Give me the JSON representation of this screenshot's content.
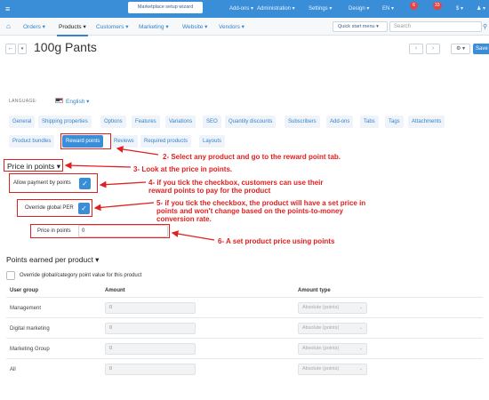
{
  "topbar": {
    "wizard_label": "Marketplace setup wizard",
    "items": [
      "Add-ons ▾",
      "Administration ▾",
      "Settings ▾",
      "Design ▾",
      "EN ▾",
      "$ ▾"
    ],
    "badge_a": "6",
    "badge_b": "33"
  },
  "nav": {
    "items": [
      "Orders ▾",
      "Products ▾",
      "Customers ▾",
      "Marketing ▾",
      "Website ▾",
      "Vendors ▾"
    ],
    "quick_start": "Quick start menu ▾",
    "search_placeholder": "Search"
  },
  "header": {
    "title": "100g Pants",
    "save_label": "Save",
    "gear_label": "⚙ ▾"
  },
  "language": {
    "label": "LANGUAGE:",
    "value": "English ▾"
  },
  "tabs_row1": [
    "General",
    "Shipping properties",
    "Options",
    "Features",
    "Variations",
    "SEO",
    "Quantity discounts",
    "Subscribers",
    "Add-ons",
    "Tabs",
    "Tags",
    "Attachments"
  ],
  "tabs_row2": [
    "Product bundles",
    "Reward points",
    "Reviews",
    "Required products",
    "Layouts"
  ],
  "price_section": {
    "heading": "Price in points ▾",
    "allow_payment_label": "Allow payment by points",
    "override_per_label": "Override global PER",
    "price_label": "Price in points",
    "price_value": "0"
  },
  "annotations": {
    "a2": "2- Select any product and go to the reward point tab.",
    "a3": "3- Look at the price in points.",
    "a4_line1": "4- if you tick the checkbox, customers can use their",
    "a4_line2": "reward points to pay for the product",
    "a5_line1": "5- if you tick the checkbox, the product will have a set price in",
    "a5_line2": "points and won't change based on the points-to-money",
    "a5_line3": "conversion rate.",
    "a6": "6- A set product price using points"
  },
  "earned_section": {
    "heading": "Points earned per product ▾",
    "override_label": "Override global/category point value for this product",
    "columns": [
      "User group",
      "Amount",
      "Amount type"
    ],
    "rows": [
      {
        "group": "Management",
        "amount": "0",
        "type": "Absolute (points)"
      },
      {
        "group": "Digital marketing",
        "amount": "0",
        "type": "Absolute (points)"
      },
      {
        "group": "Marketing Group",
        "amount": "0",
        "type": "Absolute (points)"
      },
      {
        "group": "All",
        "amount": "0",
        "type": "Absolute (points)"
      }
    ]
  },
  "colors": {
    "accent": "#3a8ed8",
    "annotation_red": "#e02020"
  }
}
